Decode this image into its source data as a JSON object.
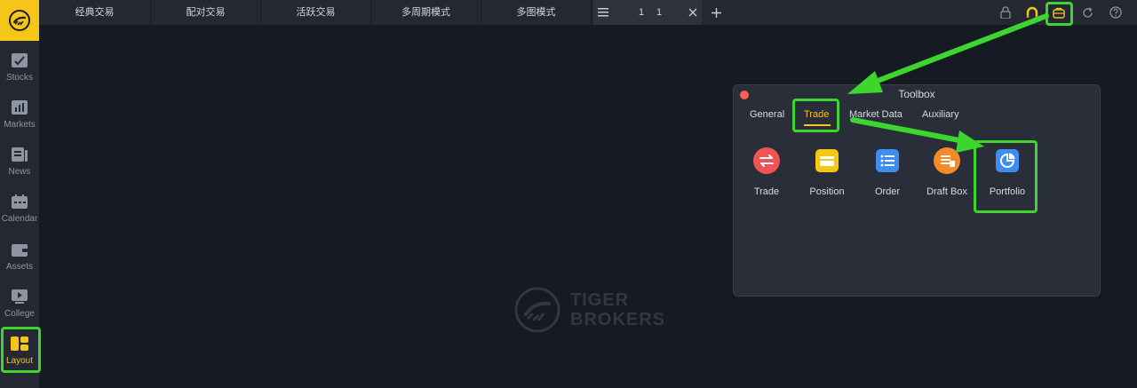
{
  "sidebar": {
    "items": [
      {
        "label": "Stocks",
        "icon": "stocks-icon"
      },
      {
        "label": "Markets",
        "icon": "markets-icon"
      },
      {
        "label": "News",
        "icon": "news-icon"
      },
      {
        "label": "Calendar",
        "icon": "calendar-icon"
      },
      {
        "label": "Assets",
        "icon": "assets-icon"
      },
      {
        "label": "College",
        "icon": "college-icon"
      },
      {
        "label": "Layout",
        "icon": "layout-icon"
      }
    ]
  },
  "topbar": {
    "tabs": [
      "经典交易",
      "配对交易",
      "活跃交易",
      "多周期模式",
      "多图模式"
    ],
    "grid_rows": "1",
    "grid_cols": "1"
  },
  "watermark": {
    "line1": "TIGER",
    "line2": "BROKERS"
  },
  "toolbox": {
    "title": "Toolbox",
    "tabs": [
      "General",
      "Trade",
      "Market Data",
      "Auxiliary"
    ],
    "active_tab": "Trade",
    "tools": [
      {
        "label": "Trade",
        "icon": "trade-icon",
        "color": "#f05454"
      },
      {
        "label": "Position",
        "icon": "position-icon",
        "color": "#f5c518"
      },
      {
        "label": "Order",
        "icon": "order-icon",
        "color": "#3d8ef0"
      },
      {
        "label": "Draft Box",
        "icon": "draft-box-icon",
        "color": "#f58a2a"
      },
      {
        "label": "Portfolio",
        "icon": "portfolio-icon",
        "color": "#3d8ef0"
      }
    ]
  },
  "colors": {
    "accent": "#f5c518",
    "highlight": "#3dd62e",
    "background": "#161a22",
    "panel": "#242832"
  }
}
